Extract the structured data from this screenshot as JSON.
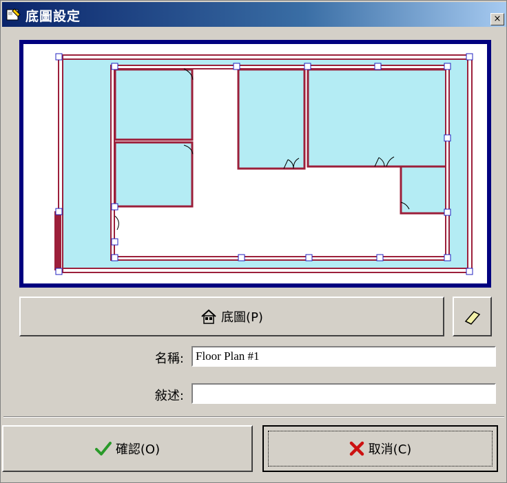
{
  "window": {
    "title": "底圖設定",
    "close_label": "×"
  },
  "toolbar": {
    "floor_plan_button": "底圖(P)"
  },
  "fields": {
    "name_label": "名稱:",
    "name_value": "Floor Plan #1",
    "description_label": "敍述:",
    "description_value": ""
  },
  "footer": {
    "ok_label": "確認(O)",
    "cancel_label": "取消(C)"
  },
  "colors": {
    "title_bar": "#0a246a",
    "preview_border": "#00007f",
    "wall": "#9c1f3a",
    "room_fill": "#b4ecf4",
    "ok_check": "#2a9a2a",
    "cancel_x": "#cc1111"
  },
  "icons": [
    "app-icon",
    "house-icon",
    "eraser-icon",
    "checkmark-icon",
    "x-icon",
    "close-icon"
  ]
}
